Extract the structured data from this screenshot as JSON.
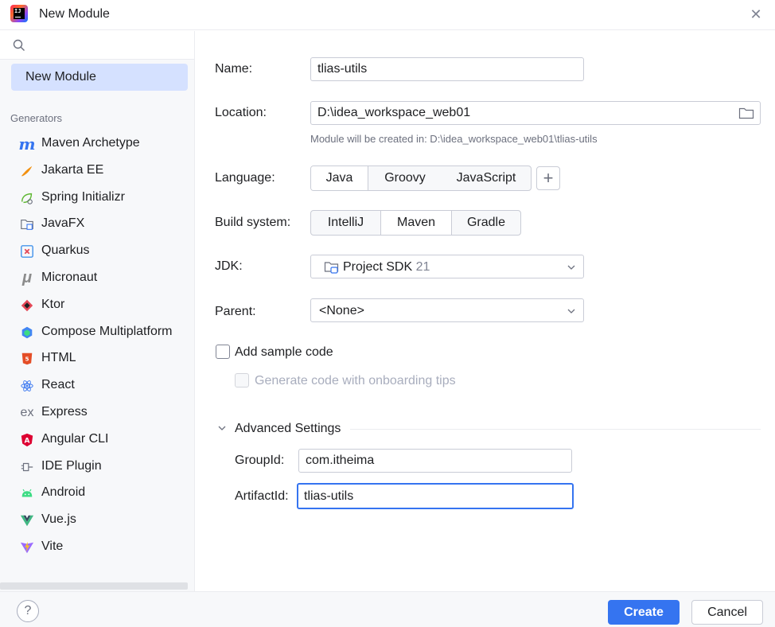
{
  "window": {
    "title": "New Module",
    "close_icon": "close-icon",
    "app_icon": "intellij-logo-icon"
  },
  "sidebar": {
    "search": {
      "placeholder": "",
      "icon": "search-icon"
    },
    "selected_item": "New Module",
    "group_label": "Generators",
    "generators": [
      {
        "label": "Maven Archetype",
        "icon": "maven-icon",
        "glyph": "m",
        "color": "#3574f0"
      },
      {
        "label": "Jakarta EE",
        "icon": "jakarta-ee-icon",
        "glyph": "",
        "color": "#f29111"
      },
      {
        "label": "Spring Initializr",
        "icon": "spring-icon",
        "glyph": "",
        "color": "#5fb832"
      },
      {
        "label": "JavaFX",
        "icon": "javafx-icon",
        "glyph": "",
        "color": "#6c707e"
      },
      {
        "label": "Quarkus",
        "icon": "quarkus-icon",
        "glyph": "",
        "color": "#4695eb"
      },
      {
        "label": "Micronaut",
        "icon": "micronaut-icon",
        "glyph": "μ",
        "color": "#8c8c8c"
      },
      {
        "label": "Ktor",
        "icon": "ktor-icon",
        "glyph": "",
        "color": "#e44857"
      },
      {
        "label": "Compose Multiplatform",
        "icon": "compose-icon",
        "glyph": "",
        "color": "#1f8a70"
      },
      {
        "label": "HTML",
        "icon": "html5-icon",
        "glyph": "5",
        "color": "#e44d26"
      },
      {
        "label": "React",
        "icon": "react-icon",
        "glyph": "",
        "color": "#61dafb"
      },
      {
        "label": "Express",
        "icon": "express-icon",
        "glyph": "ex",
        "color": "#6c707e"
      },
      {
        "label": "Angular CLI",
        "icon": "angular-icon",
        "glyph": "A",
        "color": "#dd0031"
      },
      {
        "label": "IDE Plugin",
        "icon": "plugin-icon",
        "glyph": "",
        "color": "#6c707e"
      },
      {
        "label": "Android",
        "icon": "android-icon",
        "glyph": "",
        "color": "#3ddc84"
      },
      {
        "label": "Vue.js",
        "icon": "vue-icon",
        "glyph": "",
        "color": "#41b883"
      },
      {
        "label": "Vite",
        "icon": "vite-icon",
        "glyph": "",
        "color": "#9b6cff"
      }
    ]
  },
  "form": {
    "name": {
      "label": "Name:",
      "value": "tlias-utils"
    },
    "location": {
      "label": "Location:",
      "value": "D:\\idea_workspace_web01",
      "hint": "Module will be created in: D:\\idea_workspace_web01\\tlias-utils",
      "icon": "folder-icon"
    },
    "language": {
      "label": "Language:",
      "options": [
        "Java",
        "Groovy",
        "JavaScript"
      ],
      "selected": "Java",
      "add_icon": "plus-icon"
    },
    "build_system": {
      "label": "Build system:",
      "options": [
        "IntelliJ",
        "Maven",
        "Gradle"
      ],
      "selected": "Maven"
    },
    "jdk": {
      "label": "JDK:",
      "value": "Project SDK",
      "version": "21",
      "icon": "sdk-folder-icon"
    },
    "parent": {
      "label": "Parent:",
      "value": "<None>"
    },
    "add_sample_code": {
      "label": "Add sample code",
      "checked": false
    },
    "onboarding_tips": {
      "label": "Generate code with onboarding tips",
      "checked": false,
      "enabled": false
    },
    "advanced": {
      "title": "Advanced Settings",
      "expanded": true,
      "group_id": {
        "label": "GroupId:",
        "value": "com.itheima"
      },
      "artifact_id": {
        "label": "ArtifactId:",
        "value": "tlias-utils"
      }
    }
  },
  "footer": {
    "help_label": "?",
    "create_label": "Create",
    "cancel_label": "Cancel"
  },
  "colors": {
    "accent": "#3574f0",
    "selection": "#d5e1ff",
    "border": "#c9ccd6",
    "muted_text": "#6c707e"
  }
}
